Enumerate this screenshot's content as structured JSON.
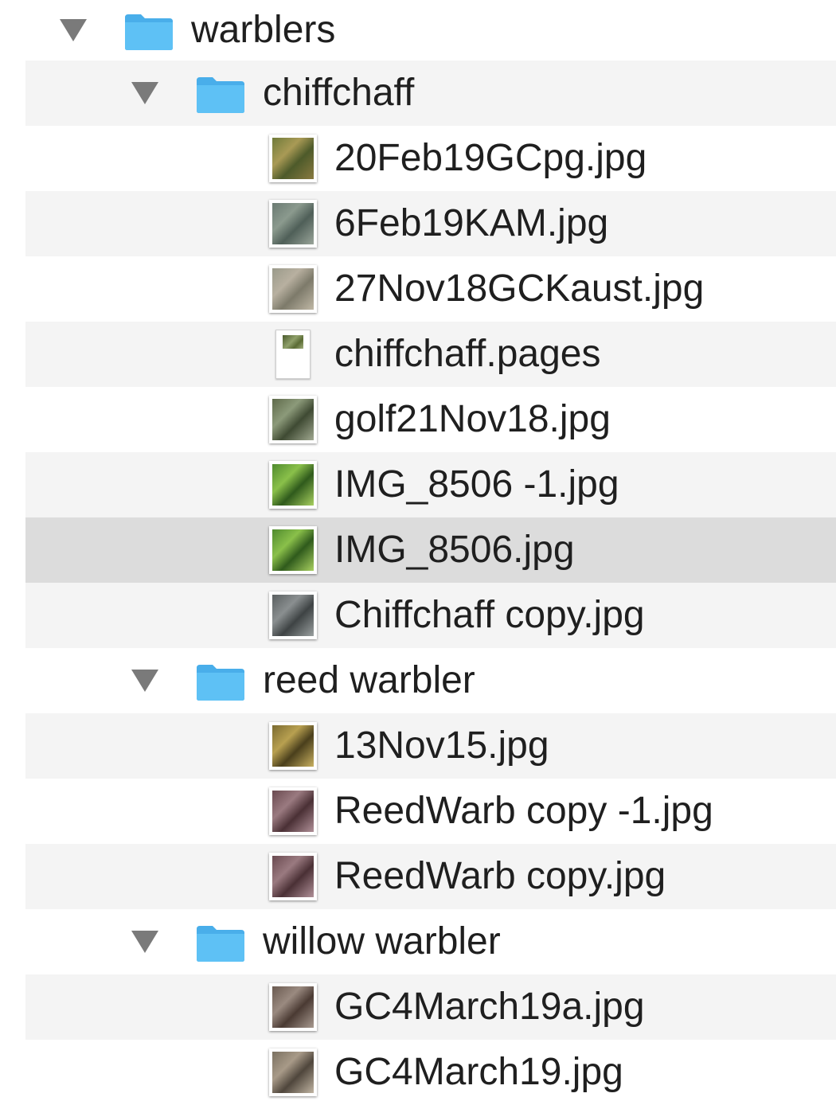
{
  "tree": {
    "root": {
      "name": "warblers",
      "icon": "folder-icon",
      "expanded": true
    },
    "folders": [
      {
        "name": "chiffchaff",
        "icon": "folder-icon",
        "expanded": true,
        "files": [
          {
            "name": "20Feb19GCpg.jpg",
            "type": "image",
            "thumb": [
              "#6f7a3a",
              "#a99a55",
              "#4d5a2a",
              "#8a7a40"
            ]
          },
          {
            "name": "6Feb19KAM.jpg",
            "type": "image",
            "thumb": [
              "#6a7a72",
              "#8b9a8e",
              "#4f5f58",
              "#9aa59a"
            ]
          },
          {
            "name": "27Nov18GCKaust.jpg",
            "type": "image",
            "thumb": [
              "#9a9a8a",
              "#b8b0a0",
              "#7d7a6a",
              "#c0b8a6"
            ]
          },
          {
            "name": "chiffchaff.pages",
            "type": "pages"
          },
          {
            "name": "golf21Nov18.jpg",
            "type": "image",
            "thumb": [
              "#5e6a4a",
              "#8c9a7a",
              "#3f4a33",
              "#a0a890"
            ]
          },
          {
            "name": "IMG_8506 -1.jpg",
            "type": "image",
            "thumb": [
              "#4f8a2e",
              "#8ac04a",
              "#2f5a1c",
              "#a8d060"
            ]
          },
          {
            "name": "IMG_8506.jpg",
            "type": "image",
            "selected": true,
            "thumb": [
              "#4f8a2e",
              "#8ac04a",
              "#2f5a1c",
              "#a8d060"
            ]
          },
          {
            "name": "Chiffchaff copy.jpg",
            "type": "image",
            "thumb": [
              "#5a5f60",
              "#8a8f90",
              "#3e4344",
              "#9aa0a0"
            ]
          }
        ]
      },
      {
        "name": "reed warbler",
        "icon": "folder-icon",
        "expanded": true,
        "files": [
          {
            "name": "13Nov15.jpg",
            "type": "image",
            "thumb": [
              "#7a6a30",
              "#b8a050",
              "#4a3f1c",
              "#c8b060"
            ]
          },
          {
            "name": "ReedWarb copy -1.jpg",
            "type": "image",
            "thumb": [
              "#6a4a50",
              "#9a7a80",
              "#4a3035",
              "#b09098"
            ]
          },
          {
            "name": "ReedWarb copy.jpg",
            "type": "image",
            "thumb": [
              "#6a4a50",
              "#9a7a80",
              "#4a3035",
              "#b09098"
            ]
          }
        ]
      },
      {
        "name": "willow warbler",
        "icon": "folder-icon",
        "expanded": true,
        "files": [
          {
            "name": "GC4March19a.jpg",
            "type": "image",
            "thumb": [
              "#6a5a50",
              "#9a8a80",
              "#4a3a33",
              "#a89a90"
            ]
          },
          {
            "name": "GC4March19.jpg",
            "type": "image",
            "thumb": [
              "#7a7060",
              "#a89a88",
              "#4f463c",
              "#c0b4a2"
            ]
          }
        ]
      }
    ]
  },
  "colors": {
    "folder_blue": "#5ec1f5",
    "folder_blue_dark": "#49aeea",
    "row_alt": "#f4f4f4",
    "row_selected": "#dcdcdc",
    "disclosure": "#7a7a7a"
  }
}
